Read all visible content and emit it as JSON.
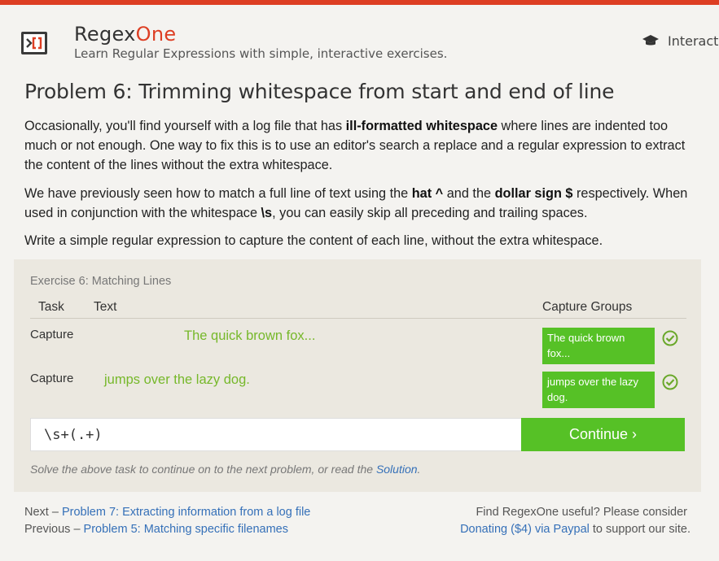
{
  "brand": {
    "name_part1": "Regex",
    "name_part2": "One",
    "tagline": "Learn Regular Expressions with simple, interactive exercises.",
    "accent_color": "#dd3e23"
  },
  "nav": {
    "interactive_label": "Interact",
    "icon": "graduation-cap-icon"
  },
  "problem": {
    "title": "Problem 6: Trimming whitespace from start and end of line",
    "p1_a": "Occasionally, you'll find yourself with a log file that has ",
    "p1_b": "ill-formatted whitespace",
    "p1_c": " where lines are indented too much or not enough. One way to fix this is to use an editor's search a replace and a regular expression to extract the content of the lines without the extra whitespace.",
    "p2_a": "We have previously seen how to match a full line of text using the ",
    "p2_b": "hat ^",
    "p2_c": " and the ",
    "p2_d": "dollar sign $",
    "p2_e": " respectively. When used in conjunction with the whitespace ",
    "p2_f": "\\s",
    "p2_g": ", you can easily skip all preceding and trailing spaces.",
    "p3": "Write a simple regular expression to capture the content of each line, without the extra whitespace."
  },
  "exercise": {
    "title": "Exercise 6: Matching Lines",
    "headers": {
      "task": "Task",
      "text": "Text",
      "capture": "Capture Groups"
    },
    "rows": [
      {
        "task": "Capture",
        "text": "The quick brown fox...",
        "capture": "The quick brown fox...",
        "status": "matched"
      },
      {
        "task": "Capture",
        "text": "jumps over the lazy dog.",
        "capture": "jumps over the lazy dog.",
        "status": "matched"
      }
    ],
    "input_value": "\\s+(.+)",
    "continue_label": "Continue ›",
    "hint_text": "Solve the above task to continue on to the next problem, or read the ",
    "hint_link": "Solution",
    "hint_end": ".",
    "success_color": "#56c126"
  },
  "footer": {
    "next_prefix": "Next – ",
    "next_link": "Problem 7: Extracting information from a log file",
    "prev_prefix": "Previous – ",
    "prev_link": "Problem 5: Matching specific filenames",
    "support_line1": "Find RegexOne useful? Please consider",
    "donate_link": "Donating ($4) via Paypal",
    "support_line2_end": " to support our site."
  }
}
